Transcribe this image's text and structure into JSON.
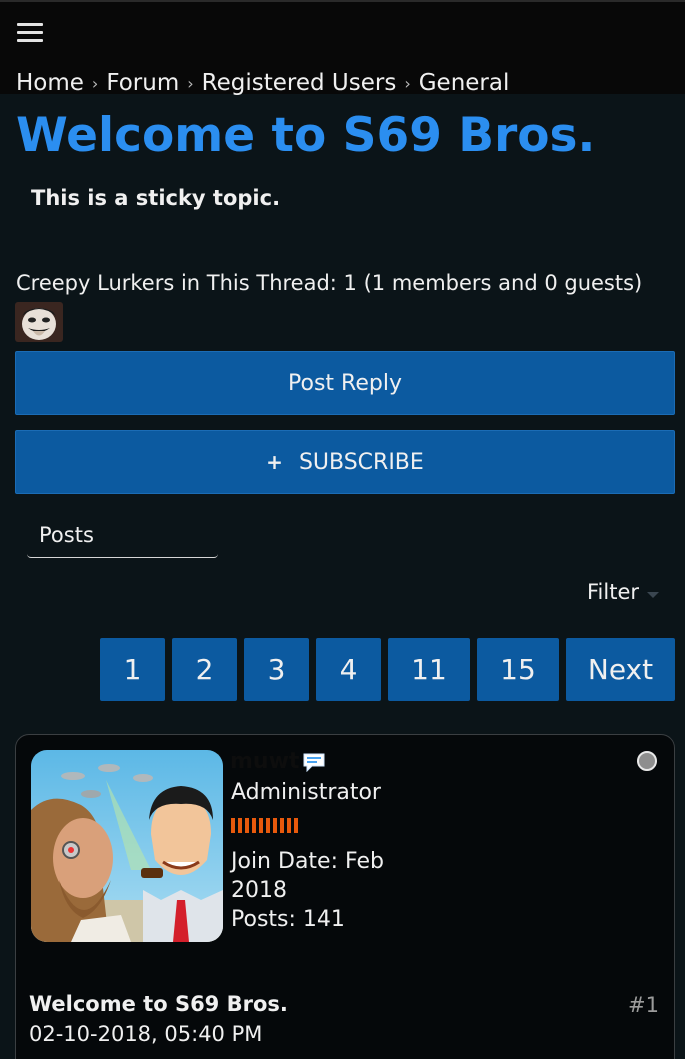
{
  "nav": {
    "breadcrumb": [
      "Home",
      "Forum",
      "Registered Users",
      "General"
    ],
    "separator": "›"
  },
  "thread": {
    "title": "Welcome to S69 Bros.",
    "sticky_note": "This is a sticky topic.",
    "lurkers_text": "Creepy Lurkers in This Thread: 1 (1 members and 0 guests)"
  },
  "actions": {
    "post_reply": "Post Reply",
    "subscribe_plus": "+",
    "subscribe": "SUBSCRIBE"
  },
  "tabs": {
    "posts": "Posts"
  },
  "filter": {
    "label": "Filter"
  },
  "pagination": [
    "1",
    "2",
    "3",
    "4",
    "11",
    "15",
    "Next"
  ],
  "post": {
    "username": "muwt",
    "role": "Administrator",
    "reputation_level": 10,
    "join_label": "Join Date:",
    "join_value": "Feb 2018",
    "posts_label": "Posts:",
    "posts_value": "141",
    "title": "Welcome to S69 Bros.",
    "number": "#1",
    "date": "02-10-2018, 05:40 PM"
  },
  "colors": {
    "accent_link": "#2b8ef0",
    "button_blue": "#0c5aa0",
    "reputation": "#e8590c",
    "background": "#0b1418"
  }
}
